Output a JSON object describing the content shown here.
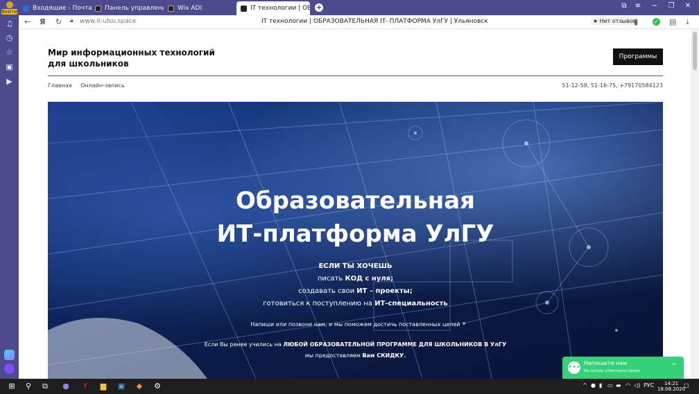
{
  "browser": {
    "login_label": "Войти",
    "tabs": [
      {
        "label": "Входящие - Почта Mail.ru",
        "color": "#2b6fd6"
      },
      {
        "label": "Панель управления | Wix",
        "color": "#222222"
      },
      {
        "label": "Wix ADI",
        "color": "#222222"
      },
      {
        "label": "IT технологии | ОБРАЗОВ...",
        "color": "#222222"
      }
    ],
    "new_tab": "+",
    "url": "www.it-ulsu.space",
    "page_title": "IT технологии | ОБРАЗОВАТЕЛЬНАЯ IT- ПЛАТФОРМА УлГУ | Ульяновск",
    "reviews_label": "★ Нет отзывов"
  },
  "site": {
    "title": "Мир информационных технологий\n для школьников",
    "programs_button": "Программы",
    "menu": [
      "Главная",
      "Онлайн-запись"
    ],
    "phones": "51-12-58, 51-16-75, +79170584123"
  },
  "hero": {
    "heading1": "Образовательная",
    "heading2": "ИТ-платформа УлГУ",
    "if_you_want": "ЕСЛИ ТЫ ХОЧЕШЬ",
    "line1_pre": "писать ",
    "line1_bold": "КОД с нуля;",
    "line2_pre": "создавать  свои ",
    "line2_bold": "ИТ – проекты;",
    "line3_pre": "готовиться к поступлению на ",
    "line3_bold": "ИТ-специальность",
    "contact_line": "Напиши или позвони нам, и мы поможем достичь поставленных целей",
    "discount_pre": "Если Вы ранее учились на ",
    "discount_bold": "ЛЮБОЙ ОБРАЗОВАТЕЛЬНОЙ ПРОГРАММЕ ДЛЯ ШКОЛЬНИКОВ В УлГУ",
    "discount2_pre": "мы предоставляем ",
    "discount2_bold": "Вам СКИДКУ."
  },
  "chat": {
    "title": "Напишите нам",
    "subtitle": "Мы онлайн и бесплатно время",
    "accent": "#36d07a"
  },
  "taskbar": {
    "lang": "РУС",
    "time": "14:21",
    "date": "18.08.2020"
  }
}
